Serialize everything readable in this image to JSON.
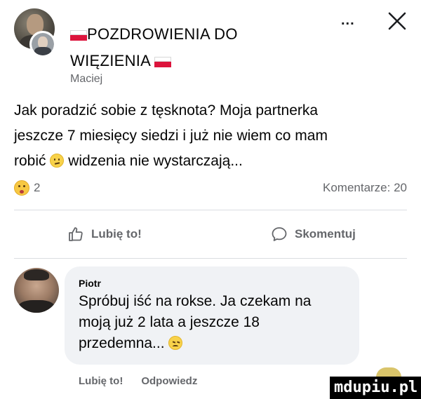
{
  "post": {
    "group_title_line1": "POZDROWIENIA DO",
    "group_title_line2": "WIĘZIENIA",
    "author": "Maciej",
    "text_line1": "Jak poradzić sobie z tęsknota? Moja partnerka",
    "text_line2": "jeszcze 7 miesięcy siedzi i już nie wiem co mam",
    "text_line3_a": "robić",
    "text_line3_b": "widzenia nie wystarczają...",
    "reactions_count": "2",
    "comments_count": "Komentarze: 20",
    "more_label": "...",
    "icons": {
      "more": "more-horizontal-icon",
      "close": "close-icon",
      "flag": "poland-flag-icon",
      "reaction": "surprised-face-emoji",
      "inline_emoji": "confused-face-emoji"
    }
  },
  "actions": {
    "like_label": "Lubię to!",
    "comment_label": "Skomentuj",
    "icons": {
      "like": "thumbs-up-icon",
      "comment": "speech-bubble-icon"
    }
  },
  "comment": {
    "author": "Piotr",
    "text_line1": "Spróbuj iść na rokse. Ja czekam na",
    "text_line2": "moją już 2 lata a jeszcze 18",
    "text_line3": "przedemna...",
    "like_label": "Lubię to!",
    "reply_label": "Odpowiedz",
    "emoji": "sad-face-emoji"
  },
  "watermark": {
    "text": "mdupiu.pl"
  },
  "colors": {
    "text": "#050505",
    "muted": "#65676b",
    "bubble": "#f0f2f5",
    "divider": "#dadde1",
    "flag_red": "#dc143c"
  }
}
